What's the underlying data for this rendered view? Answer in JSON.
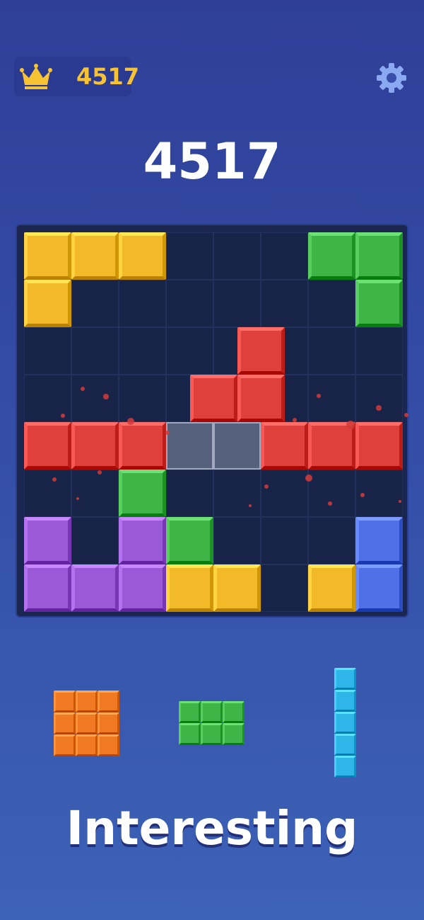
{
  "header": {
    "best_score": "4517",
    "best_icon": "crown-icon",
    "settings_icon": "gear-icon"
  },
  "score": "4517",
  "colors": {
    "yellow": "#f2b928",
    "green": "#3fb548",
    "red": "#e0403c",
    "purple": "#9a5ad8",
    "blue": "#4f70e6",
    "orange": "#f07a23",
    "cyan": "#2fb6e8"
  },
  "board": {
    "rows": 8,
    "cols": 8,
    "blocks": [
      {
        "r": 0,
        "c": 0,
        "color": "yellow"
      },
      {
        "r": 0,
        "c": 1,
        "color": "yellow"
      },
      {
        "r": 0,
        "c": 2,
        "color": "yellow"
      },
      {
        "r": 0,
        "c": 6,
        "color": "green"
      },
      {
        "r": 0,
        "c": 7,
        "color": "green"
      },
      {
        "r": 1,
        "c": 0,
        "color": "yellow"
      },
      {
        "r": 1,
        "c": 7,
        "color": "green"
      },
      {
        "r": 2,
        "c": 4.5,
        "color": "red"
      },
      {
        "r": 3,
        "c": 3.5,
        "color": "red"
      },
      {
        "r": 3,
        "c": 4.5,
        "color": "red"
      },
      {
        "r": 4,
        "c": 0,
        "color": "red"
      },
      {
        "r": 4,
        "c": 1,
        "color": "red"
      },
      {
        "r": 4,
        "c": 2,
        "color": "red"
      },
      {
        "r": 4,
        "c": 5,
        "color": "red"
      },
      {
        "r": 4,
        "c": 6,
        "color": "red"
      },
      {
        "r": 4,
        "c": 7,
        "color": "red"
      },
      {
        "r": 5,
        "c": 2,
        "color": "green"
      },
      {
        "r": 6,
        "c": 0,
        "color": "purple"
      },
      {
        "r": 6,
        "c": 2,
        "color": "purple"
      },
      {
        "r": 6,
        "c": 3,
        "color": "green"
      },
      {
        "r": 6,
        "c": 7,
        "color": "blue"
      },
      {
        "r": 7,
        "c": 0,
        "color": "purple"
      },
      {
        "r": 7,
        "c": 1,
        "color": "purple"
      },
      {
        "r": 7,
        "c": 2,
        "color": "purple"
      },
      {
        "r": 7,
        "c": 3,
        "color": "yellow"
      },
      {
        "r": 7,
        "c": 4,
        "color": "yellow"
      },
      {
        "r": 7,
        "c": 6,
        "color": "yellow"
      },
      {
        "r": 7,
        "c": 7,
        "color": "blue"
      }
    ],
    "ghost_cells": [
      {
        "r": 4,
        "c": 3
      },
      {
        "r": 4,
        "c": 4
      }
    ]
  },
  "tray": [
    {
      "name": "orange-3x3-piece",
      "color": "orange",
      "rows": 3,
      "cols": 3
    },
    {
      "name": "green-2x3-piece",
      "color": "green",
      "rows": 2,
      "cols": 3
    },
    {
      "name": "cyan-5x1-piece",
      "color": "cyan",
      "rows": 5,
      "cols": 1
    }
  ],
  "slogan": "Interesting"
}
